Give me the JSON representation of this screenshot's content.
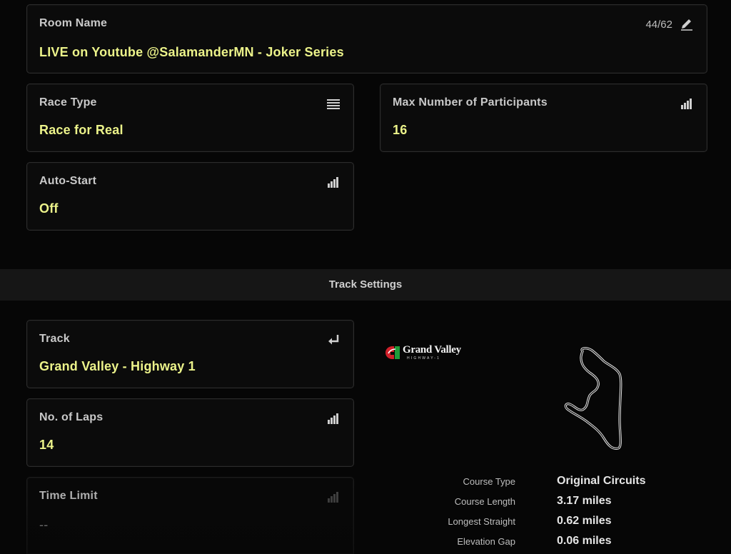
{
  "room_name": {
    "label": "Room Name",
    "value": "LIVE on Youtube @SalamanderMN - Joker Series",
    "char_count": "44/62",
    "icon": "pencil-icon"
  },
  "race_type": {
    "label": "Race Type",
    "value": "Race for Real",
    "icon": "list-icon"
  },
  "max_participants": {
    "label": "Max Number of Participants",
    "value": "16",
    "icon": "signal-bars-icon"
  },
  "auto_start": {
    "label": "Auto-Start",
    "value": "Off",
    "icon": "signal-bars-icon"
  },
  "section": {
    "title": "Track Settings"
  },
  "track": {
    "label": "Track",
    "value": "Grand Valley - Highway 1",
    "icon": "return-arrow-icon"
  },
  "laps": {
    "label": "No. of Laps",
    "value": "14",
    "icon": "signal-bars-icon"
  },
  "time_limit": {
    "label": "Time Limit",
    "value": "--",
    "icon": "signal-bars-icon"
  },
  "logo": {
    "name": "Grand Valley",
    "sub": "HIGHWAY-1"
  },
  "course_info": [
    {
      "key": "Course Type",
      "value": "Original Circuits"
    },
    {
      "key": "Course Length",
      "value": "3.17 miles"
    },
    {
      "key": "Longest Straight",
      "value": "0.62 miles"
    },
    {
      "key": "Elevation Gap",
      "value": "0.06 miles"
    }
  ],
  "colors": {
    "accent": "#ecf38a",
    "background": "#060606",
    "band": "#161616"
  }
}
